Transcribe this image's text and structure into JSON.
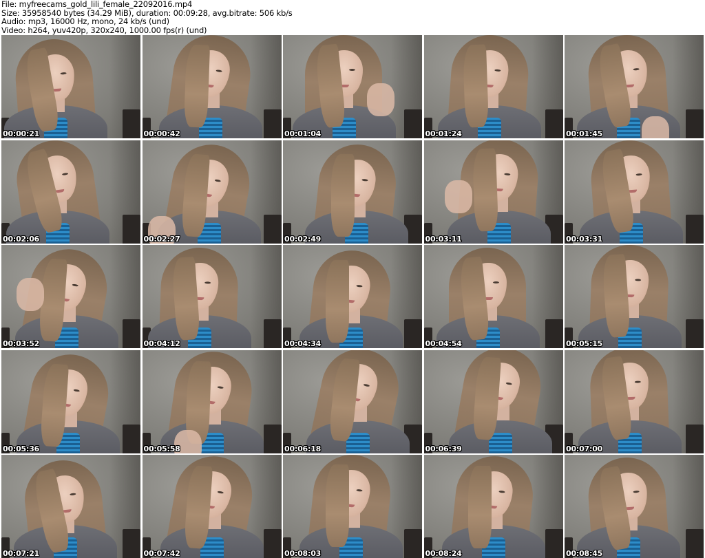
{
  "header": {
    "file_line": "File: myfreecams_gold_lili_female_22092016.mp4",
    "size_line": "Size: 35958540 bytes (34.29 MiB), duration: 00:09:28, avg.bitrate: 506 kb/s",
    "audio_line": "Audio: mp3, 16000 Hz, mono, 24 kb/s (und)",
    "video_line": "Video: h264, yuv420p, 320x240, 1000.00 fps(r) (und)"
  },
  "thumbnails": [
    {
      "timestamp": "00:00:21"
    },
    {
      "timestamp": "00:00:42"
    },
    {
      "timestamp": "00:01:04"
    },
    {
      "timestamp": "00:01:24"
    },
    {
      "timestamp": "00:01:45"
    },
    {
      "timestamp": "00:02:06"
    },
    {
      "timestamp": "00:02:27"
    },
    {
      "timestamp": "00:02:49"
    },
    {
      "timestamp": "00:03:11"
    },
    {
      "timestamp": "00:03:31"
    },
    {
      "timestamp": "00:03:52"
    },
    {
      "timestamp": "00:04:12"
    },
    {
      "timestamp": "00:04:34"
    },
    {
      "timestamp": "00:04:54"
    },
    {
      "timestamp": "00:05:15"
    },
    {
      "timestamp": "00:05:36"
    },
    {
      "timestamp": "00:05:58"
    },
    {
      "timestamp": "00:06:18"
    },
    {
      "timestamp": "00:06:39"
    },
    {
      "timestamp": "00:07:00"
    },
    {
      "timestamp": "00:07:21"
    },
    {
      "timestamp": "00:07:42"
    },
    {
      "timestamp": "00:08:03"
    },
    {
      "timestamp": "00:08:24"
    },
    {
      "timestamp": "00:08:45"
    }
  ]
}
